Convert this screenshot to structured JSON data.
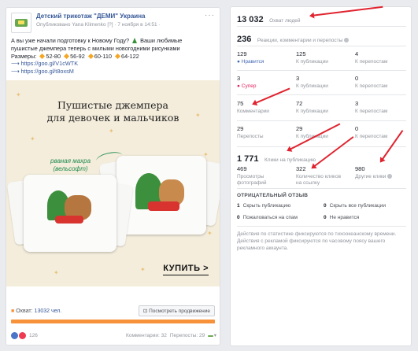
{
  "post": {
    "page_name": "Детский трикотаж \"ДЕМИ\" Украина",
    "meta": "Опубликовано Yana Klimenko [?] · 7 ноября в 14:51 ·",
    "dots": "···",
    "text_line1": "А вы уже начали подготовку к Новому Году?",
    "text_line1b": "Ваши любимые",
    "text_line2": "пушистые джемпера теперь с милыми новогодними рисунками",
    "sizes_label": "Размеры:",
    "sizes": [
      "52-80",
      "56-92",
      "60-110",
      "64-122"
    ],
    "link1": "⟶ https://goo.gl/V1cWTK",
    "link2": "⟶ https://goo.gl/t8oxsM",
    "ad_title_line1": "Пушистые джемпера",
    "ad_title_line2": "для девочек и мальчиков",
    "ad_note_line1": "рваная махра",
    "ad_note_line2": "(вельсофт)",
    "ad_cta": "КУПИТЬ >",
    "reach_label": "Охват:",
    "reach_value": "13032 чел.",
    "reach_suffix": "чел.",
    "boost_button": "Посмотреть продвижение",
    "reaction_count": "126",
    "comments": "Комментарии: 32",
    "shares": "Перепосты: 29"
  },
  "stats": {
    "reach_total": "13 032",
    "reach_label": "Охват людей",
    "engagement_total": "236",
    "engagement_label": "Реакции, комментарии и перепосты",
    "grid": [
      [
        {
          "n": "129",
          "l": "Нравится",
          "style": "blue"
        },
        {
          "n": "125",
          "l": "К публикации",
          "style": ""
        },
        {
          "n": "4",
          "l": "К перепостам",
          "style": ""
        }
      ],
      [
        {
          "n": "3",
          "l": "Супер",
          "style": "red"
        },
        {
          "n": "3",
          "l": "К публикации",
          "style": ""
        },
        {
          "n": "0",
          "l": "К перепостам",
          "style": ""
        }
      ],
      [
        {
          "n": "75",
          "l": "Комментарии",
          "style": ""
        },
        {
          "n": "72",
          "l": "К публикации",
          "style": ""
        },
        {
          "n": "3",
          "l": "К перепостам",
          "style": ""
        }
      ],
      [
        {
          "n": "29",
          "l": "Перепосты",
          "style": ""
        },
        {
          "n": "29",
          "l": "К публикации",
          "style": ""
        },
        {
          "n": "0",
          "l": "К перепостам",
          "style": ""
        }
      ]
    ],
    "clicks_total": "1 771",
    "clicks_label": "Клики на публикацию",
    "clicks": [
      {
        "n": "469",
        "l": "Просмотры фотографий"
      },
      {
        "n": "322",
        "l": "Количество кликов на ссылку"
      },
      {
        "n": "980",
        "l": "Другие клики"
      }
    ],
    "negative_title": "ОТРИЦАТЕЛЬНЫЙ ОТЗЫВ",
    "negative": [
      {
        "n": "1",
        "l": "Скрыть публикацию"
      },
      {
        "n": "0",
        "l": "Скрыть все публикации"
      },
      {
        "n": "0",
        "l": "Пожаловаться на спам"
      },
      {
        "n": "0",
        "l": "Не нравится"
      }
    ],
    "note": "Действия по статистике фиксируются по тихоокеанскому времени. Действия с рекламой фиксируются по часовому поясу вашего рекламного аккаунта."
  },
  "colors": {
    "accent": "#365899",
    "arrow": "#e0242f",
    "reach_bar": "#f7923a"
  }
}
